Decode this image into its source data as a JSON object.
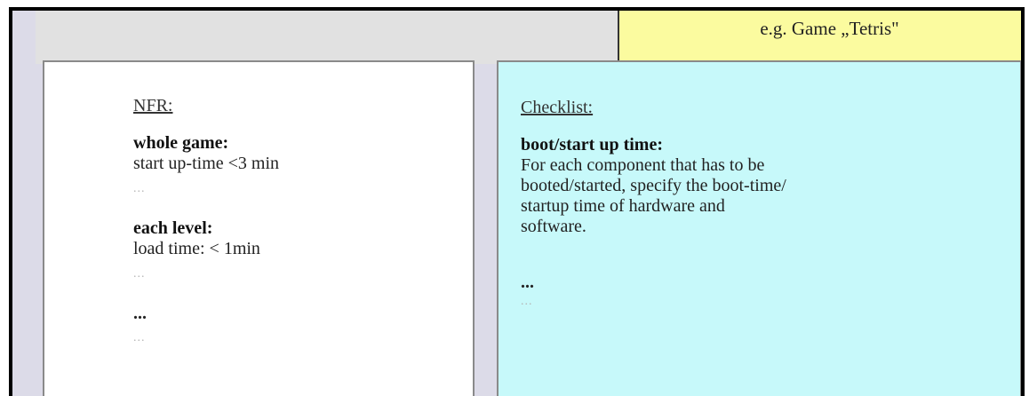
{
  "tab": {
    "label": "e.g. Game „Tetris\""
  },
  "nfr": {
    "heading": "NFR:",
    "section1_title": "whole game:",
    "section1_line": "start up-time <3 min",
    "section1_more": "...",
    "section2_title": "each level:",
    "section2_line": "load time: < 1min",
    "section2_more": "...",
    "dots": "...",
    "more": "..."
  },
  "checklist": {
    "heading": "Checklist:",
    "title": "boot/start up time:",
    "line1": "For each component that has to be",
    "line2": "booted/started, specify the boot-time/",
    "line3": "startup time of hardware and",
    "line4": "software.",
    "dots": "...",
    "more": "..."
  },
  "colors": {
    "tab_background": "#fbfb9f",
    "checklist_background": "#c7f9fa",
    "frame_background": "#dcdbe8"
  }
}
